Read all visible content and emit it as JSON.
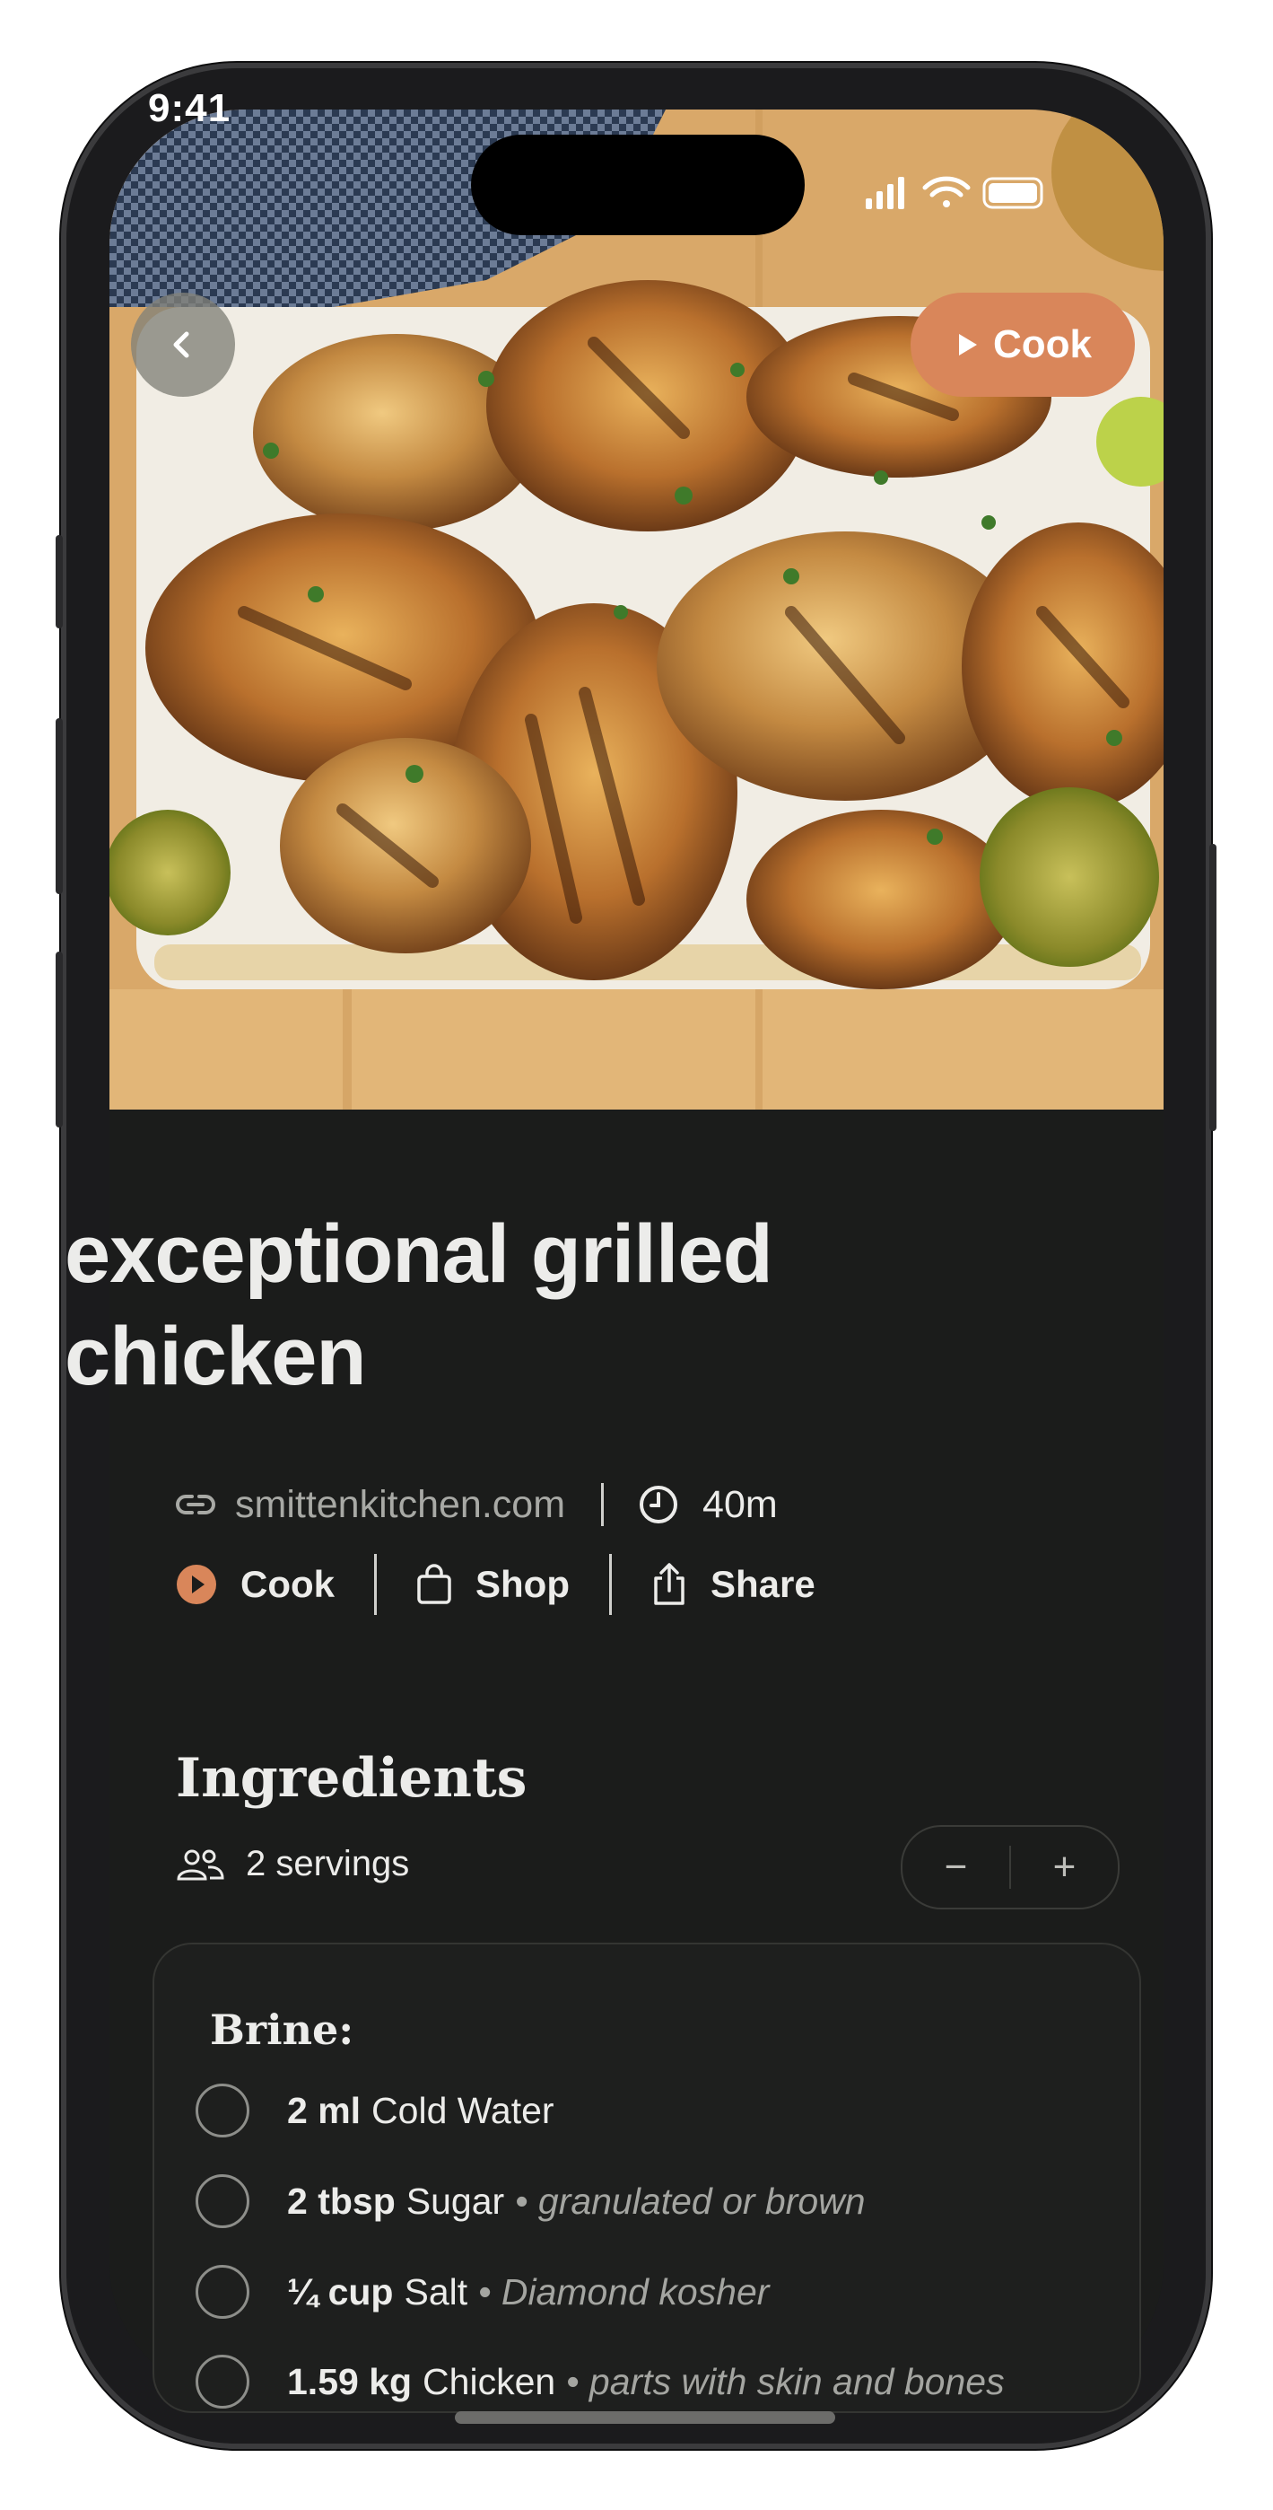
{
  "status_bar": {
    "time": "9:41"
  },
  "hero": {
    "back_icon": "chevron-left-icon",
    "cook_button": {
      "icon": "play-icon",
      "label": "Cook"
    }
  },
  "recipe": {
    "title": "exceptional grilled chicken",
    "source": {
      "icon": "link-icon",
      "label": "smittenkitchen.com"
    },
    "time": {
      "icon": "clock-icon",
      "label": "40m"
    }
  },
  "actions": [
    {
      "icon": "play-circle-icon",
      "label": "Cook",
      "color": "#d9865a"
    },
    {
      "icon": "shopping-bag-icon",
      "label": "Shop"
    },
    {
      "icon": "share-icon",
      "label": "Share"
    }
  ],
  "ingredients": {
    "title": "Ingredients",
    "servings": {
      "icon": "people-icon",
      "label": "2 servings"
    },
    "stepper": {
      "minus": "−",
      "plus": "+"
    },
    "groups": [
      {
        "title": "Brine:",
        "items": [
          {
            "qty": "2 ml",
            "name": "Cold Water",
            "note": ""
          },
          {
            "qty": "2 tbsp",
            "name": "Sugar",
            "note": "• granulated or brown"
          },
          {
            "qty": "¼ cup",
            "name": "Salt",
            "note": "• Diamond kosher"
          },
          {
            "qty": "1.59 kg",
            "name": "Chicken",
            "note": "• parts with skin and bones"
          }
        ]
      }
    ]
  },
  "colors": {
    "accent": "#d9865a",
    "background": "#1b1c1b",
    "text": "#ececea",
    "muted": "#a8a9a5"
  }
}
